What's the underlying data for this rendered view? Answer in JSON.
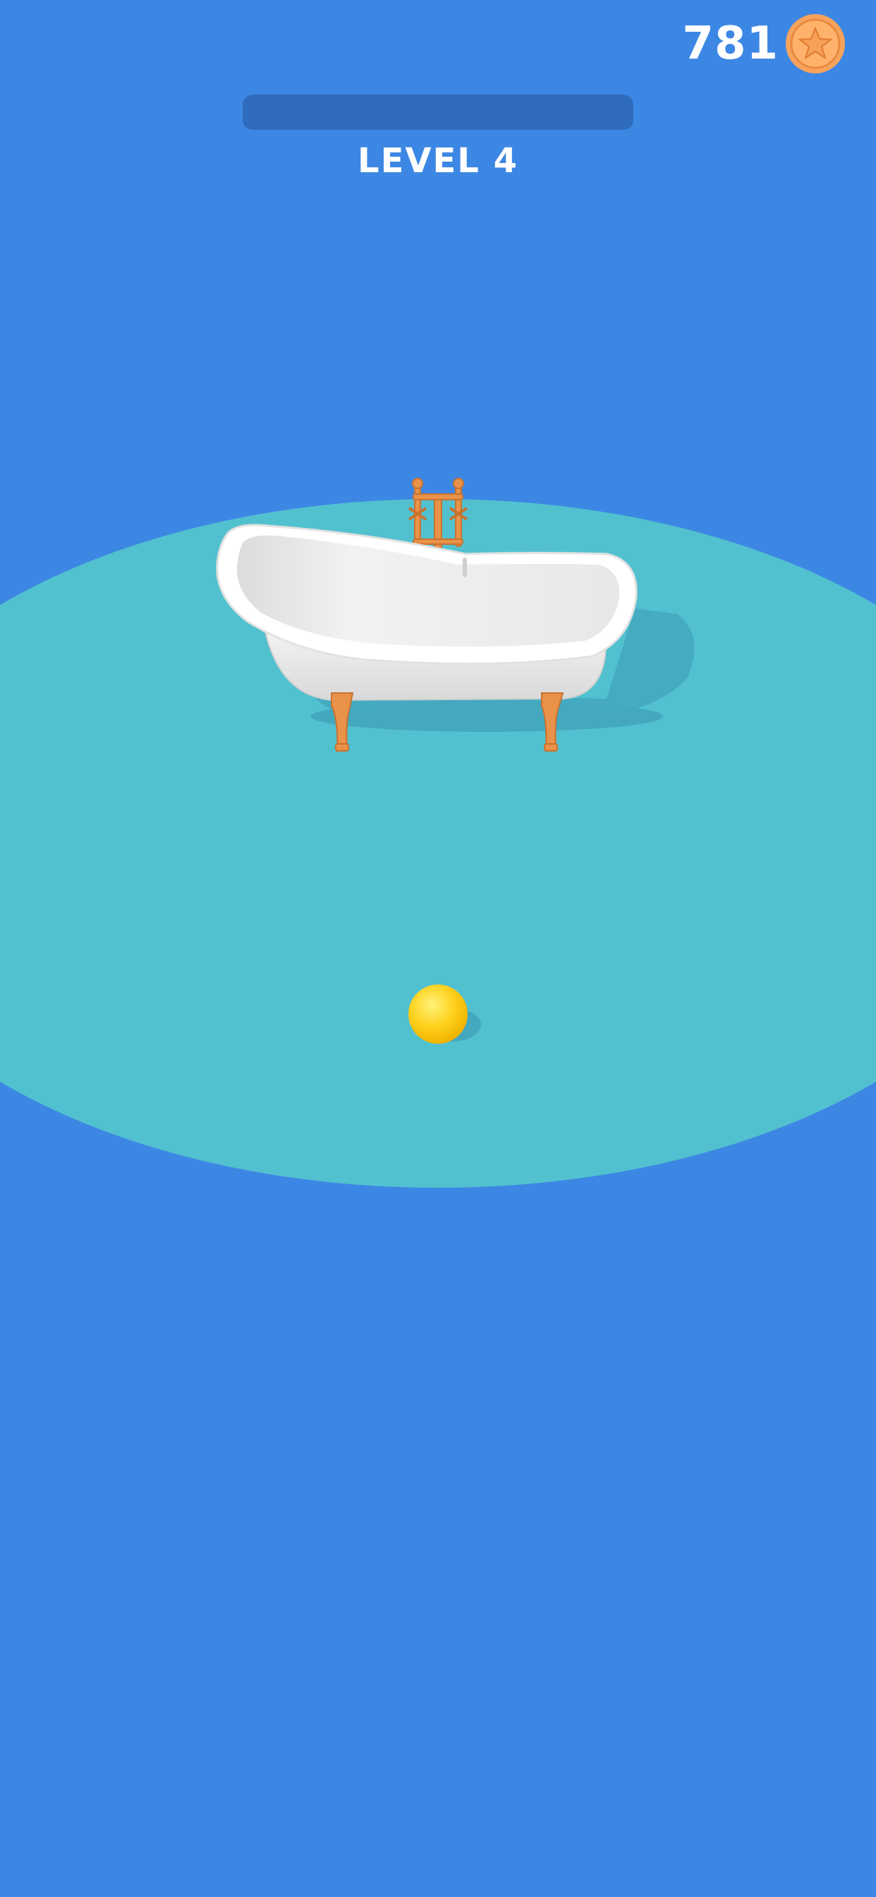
{
  "hud": {
    "coins": "781",
    "level_label": "LEVEL 4",
    "level_progress": 0
  },
  "scene": {
    "background_color": "#3d87e4",
    "platform_color": "#52c1cf",
    "objects": [
      "bathtub",
      "ball"
    ],
    "ball_color": "#ffd21f",
    "bathtub_color": "#ffffff",
    "bathtub_feet_color": "#e8924a"
  },
  "icons": {
    "coin": "coin-icon"
  }
}
